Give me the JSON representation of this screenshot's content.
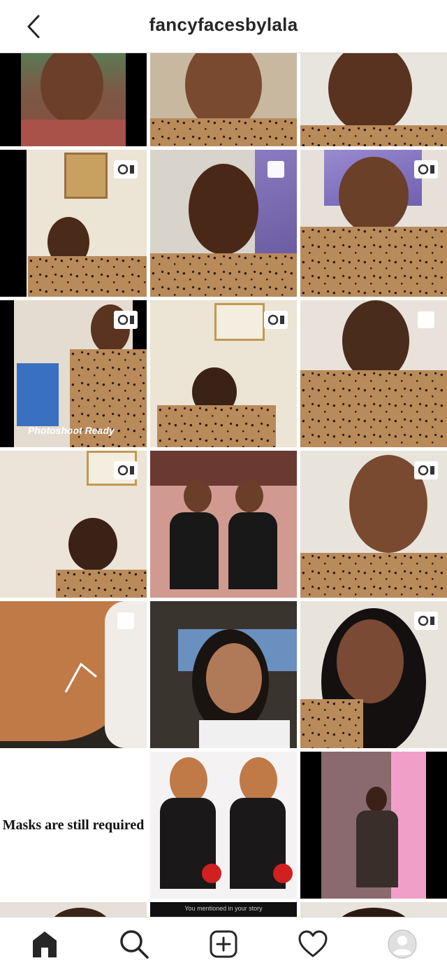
{
  "header": {
    "username": "fancyfacesbylala"
  },
  "tiles": [
    {
      "badge": "none"
    },
    {
      "badge": "none"
    },
    {
      "badge": "none"
    },
    {
      "badge": "video"
    },
    {
      "badge": "carousel"
    },
    {
      "badge": "video"
    },
    {
      "badge": "video"
    },
    {
      "badge": "video"
    },
    {
      "badge": "carousel"
    },
    {
      "badge": "video"
    },
    {
      "badge": "none"
    },
    {
      "badge": "video"
    },
    {
      "badge": "carousel"
    },
    {
      "badge": "none"
    },
    {
      "badge": "video"
    },
    {
      "badge": "none"
    },
    {
      "badge": "none"
    },
    {
      "badge": "none"
    }
  ],
  "posts": {
    "photoshoot_text": "Photoshoot Ready",
    "masks_text": "Masks are still required",
    "story_text": "You mentioned in your story"
  },
  "nav": {
    "home": "home-icon",
    "search": "search-icon",
    "create": "create-post-icon",
    "activity": "heart-icon",
    "profile": "profile-avatar-icon"
  },
  "colors": {
    "border": "#dbdbdb",
    "text": "#262626"
  }
}
